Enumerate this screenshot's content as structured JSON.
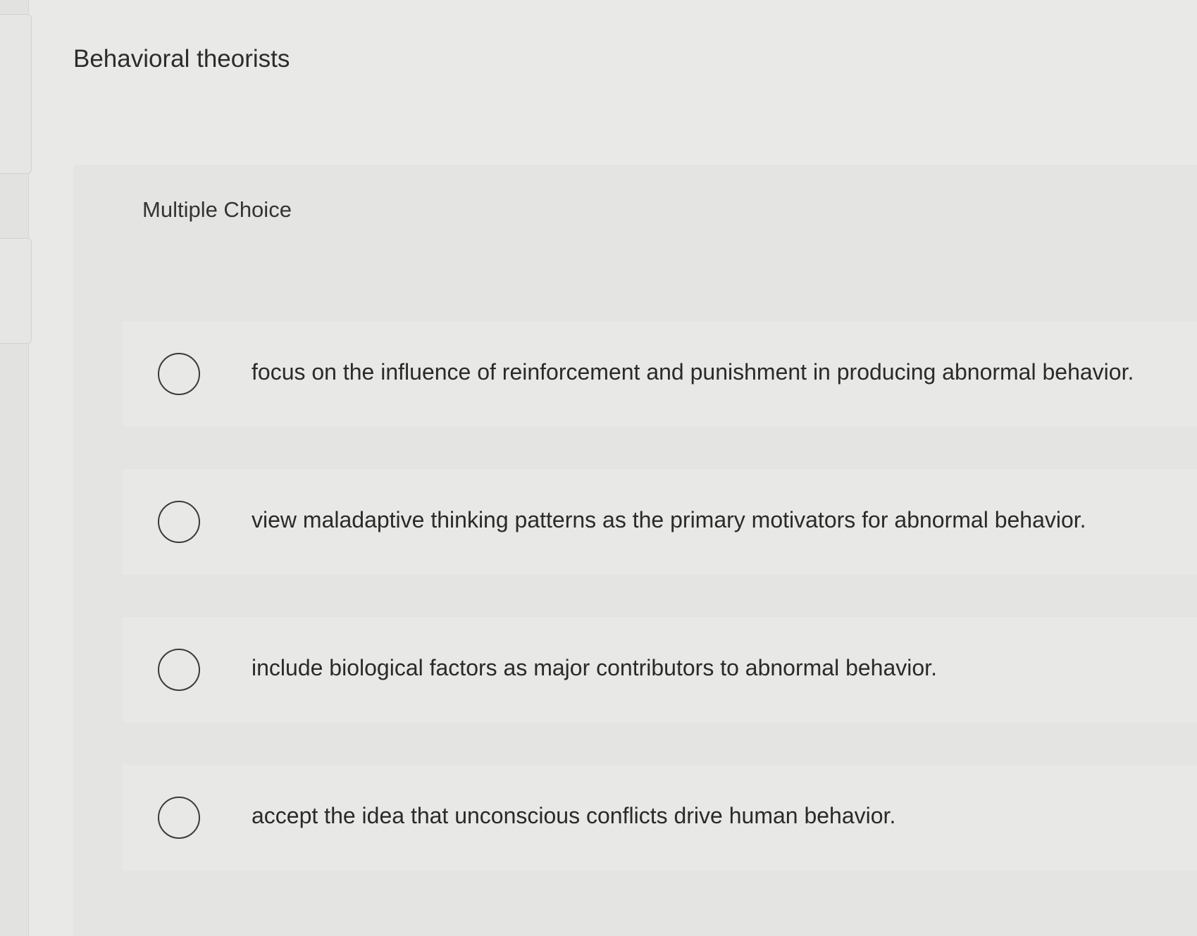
{
  "question": {
    "prompt": "Behavioral theorists",
    "type_label": "Multiple Choice",
    "choices": [
      {
        "label": "focus on the influence of reinforcement and punishment in producing abnormal behavior.",
        "selected": false
      },
      {
        "label": "view maladaptive thinking patterns as the primary motivators for abnormal behavior.",
        "selected": false
      },
      {
        "label": "include biological factors as major contributors to abnormal behavior.",
        "selected": false
      },
      {
        "label": "accept the idea that unconscious conflicts drive human behavior.",
        "selected": false
      }
    ]
  },
  "colors": {
    "background": "#e9e9e7",
    "panel": "#e4e4e2",
    "text": "#2b2b2b",
    "radio_border": "#3a3a3a"
  },
  "icons": {
    "radio": "radio-unselected-icon"
  }
}
